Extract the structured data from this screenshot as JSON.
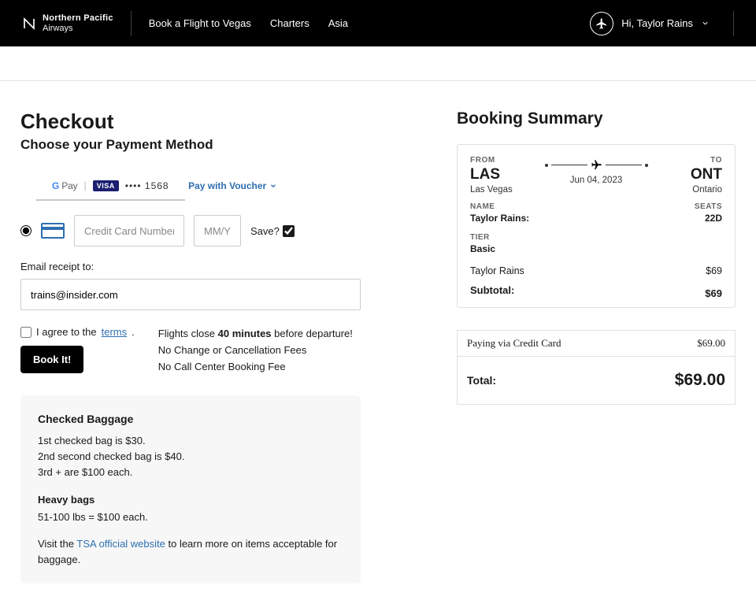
{
  "header": {
    "brand_top": "Northern Pacific",
    "brand_bot": "Airways",
    "nav": [
      "Book a Flight to Vegas",
      "Charters",
      "Asia"
    ],
    "user_greeting": "Hi, Taylor Rains"
  },
  "checkout": {
    "title": "Checkout",
    "subtitle": "Choose your Payment Method",
    "gpay_label": "Pay",
    "visa_label": "VISA",
    "card_masked": "•••• 1568",
    "voucher_label": "Pay with Voucher",
    "cc_placeholder": "Credit Card Number",
    "exp_placeholder": "MM/YY",
    "save_label": "Save?",
    "email_label": "Email receipt to:",
    "email_value": "trains@insider.com",
    "terms_prefix": "I agree to the ",
    "terms_link": "terms",
    "terms_suffix": ".",
    "book_label": "Book It!",
    "policy_line1_pre": "Flights close ",
    "policy_line1_bold": "40 minutes",
    "policy_line1_post": " before departure!",
    "policy_line2": "No Change or Cancellation Fees",
    "policy_line3": "No Call Center Booking Fee"
  },
  "baggage": {
    "title": "Checked Baggage",
    "line1": "1st checked bag is $30.",
    "line2": "2nd second checked bag is $40.",
    "line3": "3rd + are $100 each.",
    "heavy_title": "Heavy bags",
    "heavy_line": "51-100 lbs = $100 each.",
    "foot_pre": "Visit the ",
    "foot_link": "TSA official website",
    "foot_post": " to learn more on items acceptable for baggage."
  },
  "summary": {
    "title": "Booking Summary",
    "from_label": "FROM",
    "to_label": "TO",
    "from_code": "LAS",
    "from_city": "Las Vegas",
    "to_code": "ONT",
    "to_city": "Ontario",
    "date": "Jun 04, 2023",
    "name_label": "NAME",
    "name_value": "Taylor Rains:",
    "seats_label": "SEATS",
    "seats_value": "22D",
    "tier_label": "TIER",
    "tier_value": "Basic",
    "pax_name": "Taylor Rains",
    "pax_price": "$69",
    "subtotal_label": "Subtotal:",
    "subtotal_value": "$69",
    "paying_label": "Paying via Credit Card",
    "paying_amount": "$69.00",
    "total_label": "Total:",
    "total_amount": "$69.00"
  }
}
